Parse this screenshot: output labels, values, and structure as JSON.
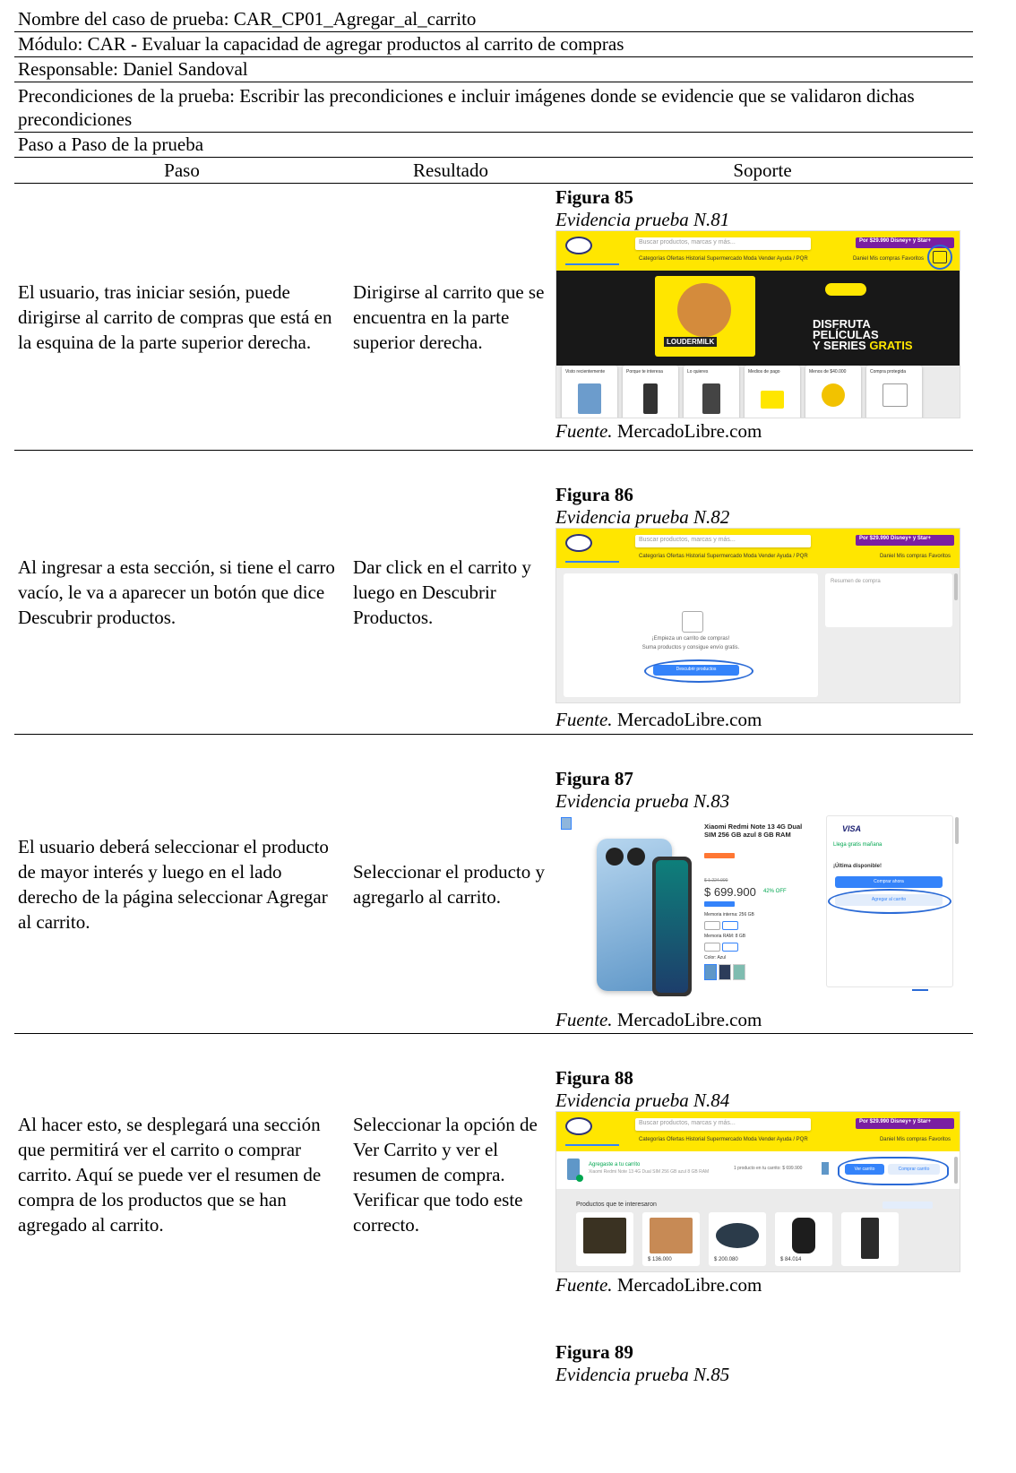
{
  "header_rows": {
    "test_case_name": "Nombre del caso de prueba: CAR_CP01_Agregar_al_carrito",
    "module": "Módulo: CAR - Evaluar la capacidad de agregar productos al carrito de compras",
    "responsible": "Responsable: Daniel Sandoval",
    "preconditions": "Precondiciones de la prueba: Escribir las precondiciones e incluir imágenes donde se evidencie que se validaron dichas precondiciones",
    "step_by_step": "Paso a Paso de la prueba"
  },
  "columns": {
    "paso": "Paso",
    "resultado": "Resultado",
    "soporte": "Soporte"
  },
  "steps": [
    {
      "paso": "El usuario, tras iniciar sesión, puede dirigirse al carrito de compras que está en la esquina de la parte superior derecha.",
      "resultado": "Dirigirse al carrito que se encuentra en la parte superior derecha.",
      "figure_label": "Figura 85",
      "figure_title": "Evidencia prueba N.81",
      "source_prefix": "Fuente.",
      "source": " MercadoLibre.com"
    },
    {
      "paso": "Al ingresar a esta sección, si tiene el carro vacío, le va a aparecer un botón que dice Descubrir productos.",
      "resultado": "Dar click en el carrito y luego en Descubrir Productos.",
      "figure_label": "Figura 86",
      "figure_title": "Evidencia prueba N.82",
      "source_prefix": "Fuente.",
      "source": " MercadoLibre.com"
    },
    {
      "paso": "El usuario deberá seleccionar el producto de mayor interés y luego en el lado derecho de la página seleccionar Agregar al carrito.",
      "resultado": "Seleccionar el producto y agregarlo al carrito.",
      "figure_label": "Figura 87",
      "figure_title": "Evidencia prueba N.83",
      "source_prefix": "Fuente.",
      "source": " MercadoLibre.com"
    },
    {
      "paso": "Al hacer esto, se desplegará una sección que permitirá ver el carrito o comprar carrito. Aquí se puede ver el resumen de compra de los productos que se han agregado al carrito.",
      "resultado": "Seleccionar la opción de Ver Carrito y ver el resumen de compra. Verificar que todo este correcto.",
      "figure_label": "Figura 88",
      "figure_title": "Evidencia prueba N.84",
      "source_prefix": "Fuente.",
      "source": " MercadoLibre.com"
    },
    {
      "figure_label": "Figura 89",
      "figure_title": "Evidencia prueba N.85"
    }
  ],
  "screenshots": {
    "brand_color": "#ffe600",
    "accent_color": "#3483fa",
    "annotation_color": "#2a6ad6",
    "fig85": {
      "search_placeholder": "Buscar productos, marcas y más...",
      "promo": "Por $29.990 Disney+ y Star+",
      "nav": "Categorías   Ofertas   Historial   Supermercado   Moda   Vender   Ayuda / PQR",
      "nav_right": "Daniel    Mis compras    Favoritos",
      "banner_line1": "DISFRUTA",
      "banner_line2": "PELÍCULAS",
      "banner_line3": "Y SERIES",
      "banner_line3b": "GRATIS",
      "banner_badge": "LOUDERMILK",
      "cards": [
        "Visto recientemente",
        "Porque te interesa",
        "Lo quieres",
        "Medios de pago",
        "Menos de $40.000",
        "Compra protegida"
      ]
    },
    "fig86": {
      "summary_title": "Resumen de compra",
      "empty_title": "¡Empieza un carrito de compras!",
      "empty_sub": "Suma productos y consigue envío gratis.",
      "discover_button": "Descubrir productos"
    },
    "fig87": {
      "product_title": "Xiaomi Redmi Note 13 4G Dual SIM 256 GB azul 8 GB RAM",
      "old_price": "$ 1.224.900",
      "price": "$ 699.900",
      "discount": "42% OFF",
      "memory": "Memoria interna: 256 GB",
      "ram": "Memoria RAM: 8 GB",
      "color": "Color: Azul",
      "visa": "VISA",
      "free_shipping": "Llega gratis mañana",
      "stock": "¡Última disponible!",
      "buy_now": "Comprar ahora",
      "add_to_cart": "Agregar al carrito"
    },
    "fig88": {
      "added_title": "Agregaste a tu carrito",
      "added_sub": "Xiaomi Redmi Note 13 4G Dual SIM 256 GB azul 8 GB RAM",
      "cart_summary": "1 producto en tu carrito: $ 699.900",
      "view_cart": "Ver carrito",
      "buy_cart": "Comprar carrito",
      "recs_title": "Productos que te interesaron",
      "recs_prices": [
        "$ 136.000",
        "$ 200.080",
        "$ 84.014"
      ]
    }
  }
}
